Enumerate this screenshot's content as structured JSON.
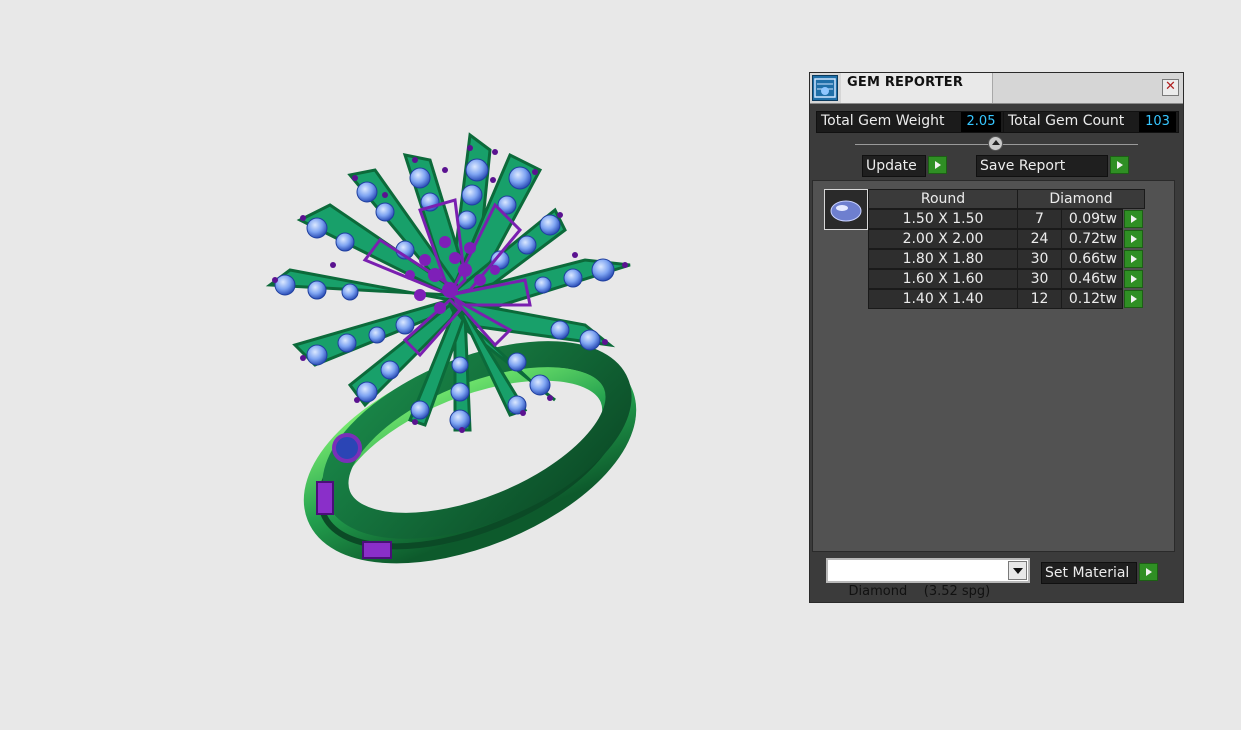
{
  "panel": {
    "title": "GEM REPORTER",
    "total_weight_label": "Total Gem Weight",
    "total_weight_value": "2.05",
    "total_count_label": "Total Gem Count",
    "total_count_value": "103",
    "update_label": "Update",
    "save_report_label": "Save Report",
    "table": {
      "shape_header": "Round",
      "material_header": "Diamond",
      "rows": [
        {
          "size": "1.50 X 1.50",
          "count": "7",
          "weight": "0.09tw"
        },
        {
          "size": "2.00 X 2.00",
          "count": "24",
          "weight": "0.72tw"
        },
        {
          "size": "1.80 X 1.80",
          "count": "30",
          "weight": "0.66tw"
        },
        {
          "size": "1.60 X 1.60",
          "count": "30",
          "weight": "0.46tw"
        },
        {
          "size": "1.40 X 1.40",
          "count": "12",
          "weight": "0.12tw"
        }
      ]
    },
    "material_select_value": "Diamond    (3.52 spg)",
    "set_material_label": "Set Material"
  },
  "colors": {
    "accent_green": "#2f8f24",
    "value_cyan": "#37c6ff",
    "panel_bg": "#3b3b3b"
  }
}
